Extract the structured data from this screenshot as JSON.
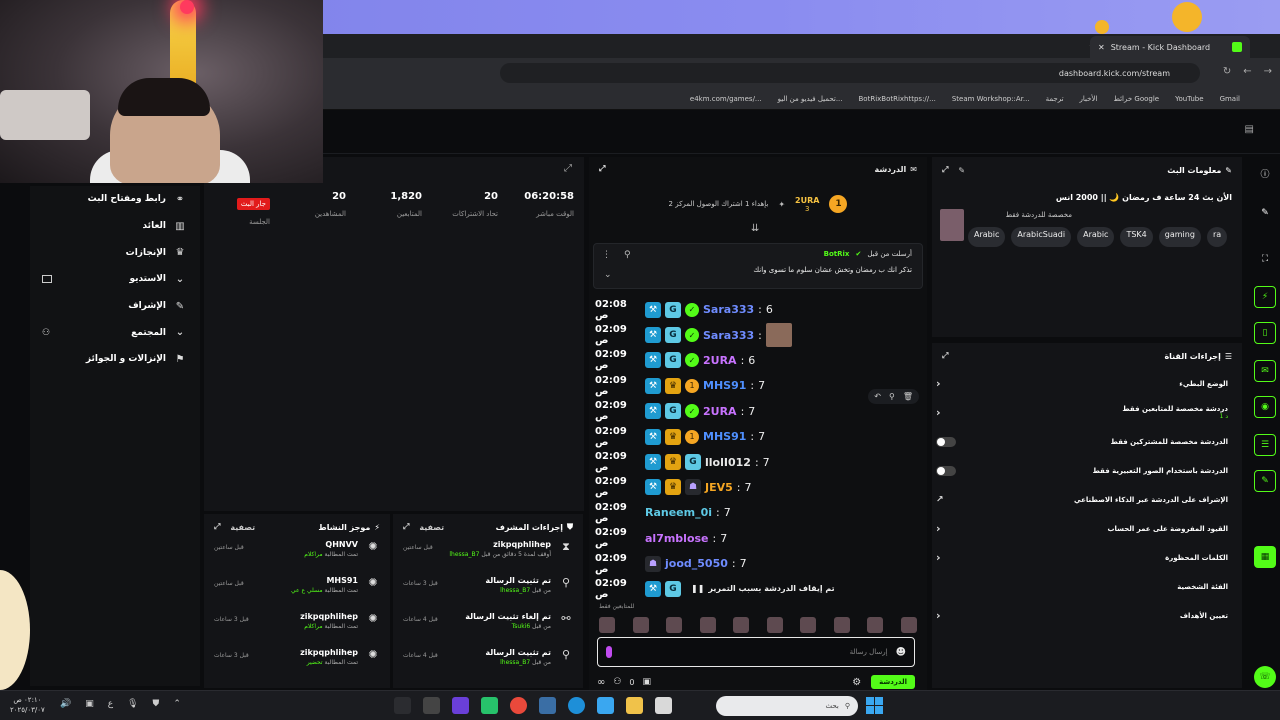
{
  "browser": {
    "tab_title": "Stream - Kick Dashboard",
    "url": "dashboard.kick.com/stream",
    "bookmarks": [
      "Gmail",
      "YouTube",
      "خرائط Google",
      "الأخبار",
      "ترجمة",
      "Steam Workshop::Ar...",
      "BotRixBotRixhttps://...",
      "تحميل فيديو من اليو...",
      "e4km.com/games/..."
    ]
  },
  "sidebar": {
    "items": [
      {
        "label": "رابط ومفتاح البث",
        "icon": "link-icon"
      },
      {
        "label": "العائد",
        "icon": "chart-icon"
      },
      {
        "label": "الإنجازات",
        "icon": "trophy-icon"
      },
      {
        "label": "الاستديو",
        "icon": "studio-icon"
      },
      {
        "label": "الإشراف",
        "icon": "wrench-icon"
      },
      {
        "label": "المجتمع",
        "icon": "community-icon"
      },
      {
        "label": "الإنزالات و الجوائز",
        "icon": "drops-icon"
      }
    ]
  },
  "stats": {
    "live_badge": "جار البث",
    "session_label": "الجلسة",
    "items": [
      {
        "value": "06:20:58",
        "label": "الوقت مباشر"
      },
      {
        "value": "20",
        "label": "تحاد الاشتراكات"
      },
      {
        "value": "1,820",
        "label": "المتابعين"
      },
      {
        "value": "20",
        "label": "المشاهدين"
      }
    ]
  },
  "activity": {
    "title": "موجز النشاط",
    "filter": "تصفية",
    "items": [
      {
        "user": "QHNVV",
        "line": "تمت المطالبة",
        "reward": "مراكلام",
        "time": "قبل ساعتين"
      },
      {
        "user": "MHS91",
        "line": "تمت المطالبة",
        "reward": "مسلي ع عي",
        "time": "قبل ساعتين"
      },
      {
        "user": "zikpqphlihep",
        "line": "تمت المطالبة",
        "reward": "مراكلام",
        "time": "قبل 3 ساعات"
      },
      {
        "user": "zikpqphlihep",
        "line": "تمت المطالبة",
        "reward": "تحضير",
        "time": "قبل 3 ساعات"
      }
    ]
  },
  "modlog": {
    "title": "إجراءات المشرف",
    "filter": "تصفية",
    "items": [
      {
        "user": "zikpqphlihep",
        "line": "أوقف لمدة 5 دقائق من قبل",
        "actor": "lhessa_B7",
        "time": "قبل ساعتين",
        "icon": "hourglass-icon"
      },
      {
        "user": "تم تثبيت الرسالة",
        "line": "من قبل",
        "actor": "lhessa_B7",
        "time": "قبل 3 ساعات",
        "icon": "pin-icon"
      },
      {
        "user": "تم إلغاء تثبيت الرسالة",
        "line": "من قبل",
        "actor": "Tsuki6",
        "time": "قبل 4 ساعات",
        "icon": "unpin-icon"
      },
      {
        "user": "تم تثبيت الرسالة",
        "line": "من قبل",
        "actor": "lhessa_B7",
        "time": "قبل 4 ساعات",
        "icon": "pin-icon"
      }
    ]
  },
  "chat": {
    "title": "الدردشة",
    "goal": {
      "coin": "1",
      "name": "2URA",
      "count": "3",
      "text": "بإهداء 1 اشتراك الوصول المركز 2"
    },
    "pinned": {
      "header": "أرسلت من قبل",
      "bot": "BotRix",
      "text": "تذكر انك ب رمضان وتخش عشان سلوم ما تسوى وانك"
    },
    "messages": [
      {
        "time": "02:08 ص",
        "user": "Sara333",
        "color": "#6f8cff",
        "text": "6",
        "badges": [
          "mod",
          "vip",
          "ok"
        ]
      },
      {
        "time": "02:09 ص",
        "user": "Sara333",
        "color": "#6f8cff",
        "text": "",
        "badges": [
          "mod",
          "vip",
          "ok"
        ],
        "emote": true
      },
      {
        "time": "02:09 ص",
        "user": "2URA",
        "color": "#c873ff",
        "text": "6",
        "badges": [
          "mod",
          "vip",
          "ok"
        ]
      },
      {
        "time": "02:09 ص",
        "user": "MHS91",
        "color": "#4f90ff",
        "text": "7",
        "badges": [
          "mod",
          "crown",
          "one"
        ]
      },
      {
        "time": "02:09 ص",
        "user": "2URA",
        "color": "#c873ff",
        "text": "7",
        "badges": [
          "mod",
          "vip",
          "ok"
        ]
      },
      {
        "time": "02:09 ص",
        "user": "MHS91",
        "color": "#4f90ff",
        "text": "7",
        "badges": [
          "mod",
          "crown",
          "one"
        ]
      },
      {
        "time": "02:09 ص",
        "user": "llolI012",
        "color": "#e8e8e8",
        "text": "7",
        "badges": [
          "mod",
          "crown",
          "vip"
        ]
      },
      {
        "time": "02:09 ص",
        "user": "JEV5",
        "color": "#f5a623",
        "text": "7",
        "badges": [
          "mod",
          "crown",
          "sub"
        ]
      },
      {
        "time": "02:09 ص",
        "user": "Raneem_0i",
        "color": "#5ec9e5",
        "text": "7",
        "badges": []
      },
      {
        "time": "02:09 ص",
        "user": "al7mblose",
        "color": "#c873ff",
        "text": "7",
        "badges": []
      },
      {
        "time": "02:09 ص",
        "user": "jood_5050",
        "color": "#6f8cff",
        "text": "7",
        "badges": [
          "sub"
        ]
      },
      {
        "time": "02:09 ص",
        "user": "",
        "color": "#e8e8e8",
        "text": "تم إيقاف الدردشة بسبب التمرير",
        "badges": [
          "mod",
          "vip"
        ],
        "paused": true
      }
    ],
    "subs_only": "للمتابعين فقط",
    "input_placeholder": "إرسال رسالة",
    "count": "0",
    "send": "الدردشة"
  },
  "stream_info": {
    "panel_title": "معلومات البث",
    "title": "الأن بث 24 ساعة ف رمضان 🌙 || 2000 انس",
    "category": "مخصصة للدردشة فقط",
    "tags": [
      "Arabic",
      "ArabicSuadi",
      "Arabic",
      "TSK4",
      "gaming",
      "ra"
    ]
  },
  "channel_actions": {
    "title": "إجراءات القناة",
    "items": [
      {
        "label": "الوضع البطيء",
        "type": "chevron"
      },
      {
        "label": "دردشة مخصصة للمتابعين فقط",
        "sub": "1 د",
        "type": "chevron"
      },
      {
        "label": "الدردشة مخصصة للمشتركين فقط",
        "type": "toggle"
      },
      {
        "label": "الدردشة باستخدام الصور التعبيرية فقط",
        "type": "toggle"
      },
      {
        "label": "الإشراف على الدردشة عبر الذكاء الاصطناعي",
        "type": "external"
      },
      {
        "label": "القيود المفروضة على عمر الحساب",
        "type": "chevron"
      },
      {
        "label": "الكلمات المحظورة",
        "type": "chevron"
      },
      {
        "label": "الفئة الشخصية",
        "type": "none"
      },
      {
        "label": "تعيين الأهداف",
        "type": "chevron"
      }
    ]
  },
  "taskbar": {
    "time": "٠٢:١٠ ص",
    "date": "٢٠٢٥/٠٣/٠٧",
    "lang": "ع",
    "search_placeholder": "بحث"
  }
}
